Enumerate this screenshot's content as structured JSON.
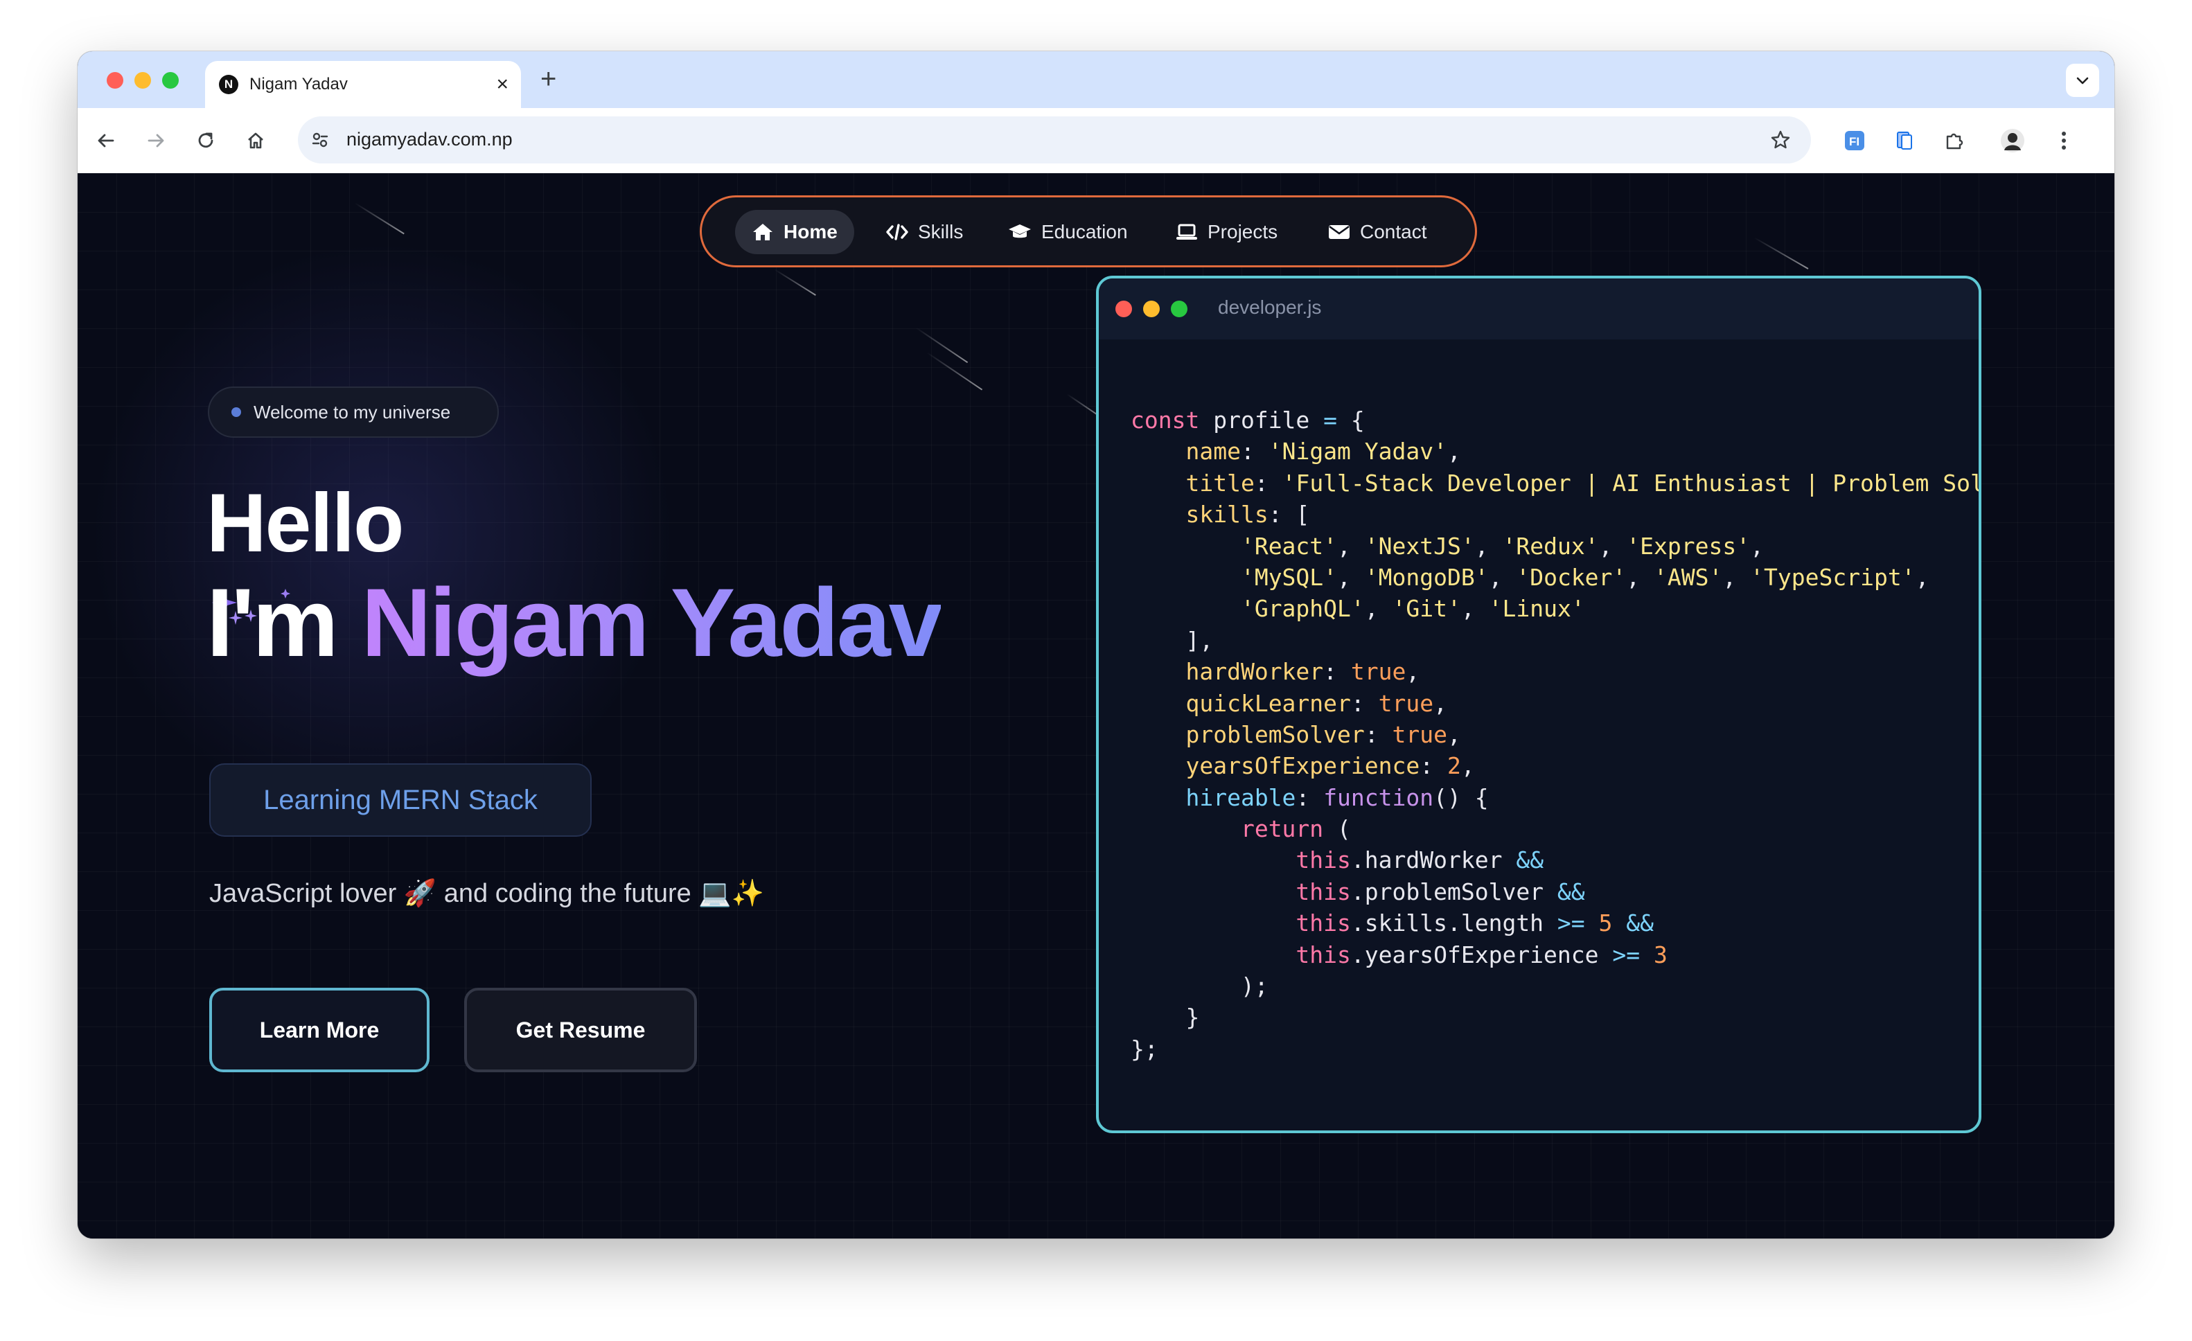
{
  "browser": {
    "tab_title": "Nigam Yadav",
    "tab_favicon_letter": "N",
    "url": "nigamyadav.com.np",
    "icons": [
      "back-icon",
      "forward-icon",
      "reload-icon",
      "home-icon",
      "site-settings-icon",
      "bookmark-star-icon",
      "extension-icon",
      "reading-mode-icon",
      "puzzle-icon",
      "profile-avatar",
      "more-menu-icon"
    ]
  },
  "nav": {
    "items": [
      {
        "label": "Home",
        "icon": "home-icon",
        "active": true
      },
      {
        "label": "Skills",
        "icon": "code-icon",
        "active": false
      },
      {
        "label": "Education",
        "icon": "graduation-cap-icon",
        "active": false
      },
      {
        "label": "Projects",
        "icon": "laptop-icon",
        "active": false
      },
      {
        "label": "Contact",
        "icon": "envelope-icon",
        "active": false
      }
    ],
    "border_color": "#e06a3c"
  },
  "hero": {
    "welcome": "Welcome to my universe",
    "hello": "Hello",
    "im": "I'm ",
    "name": "Nigam Yadav",
    "typing_text": "Learning MERN Stack",
    "tagline": "JavaScript lover 🚀 and coding the future 💻✨",
    "learn_more": "Learn More",
    "get_resume": "Get Resume"
  },
  "code_window": {
    "filename": "developer.js",
    "accent": "#5ec8d4"
  },
  "colors": {
    "page_bg": "#080b18",
    "name_gradient": [
      "#c084fc",
      "#818cf8"
    ],
    "typing_text": "#6ea0ea"
  }
}
